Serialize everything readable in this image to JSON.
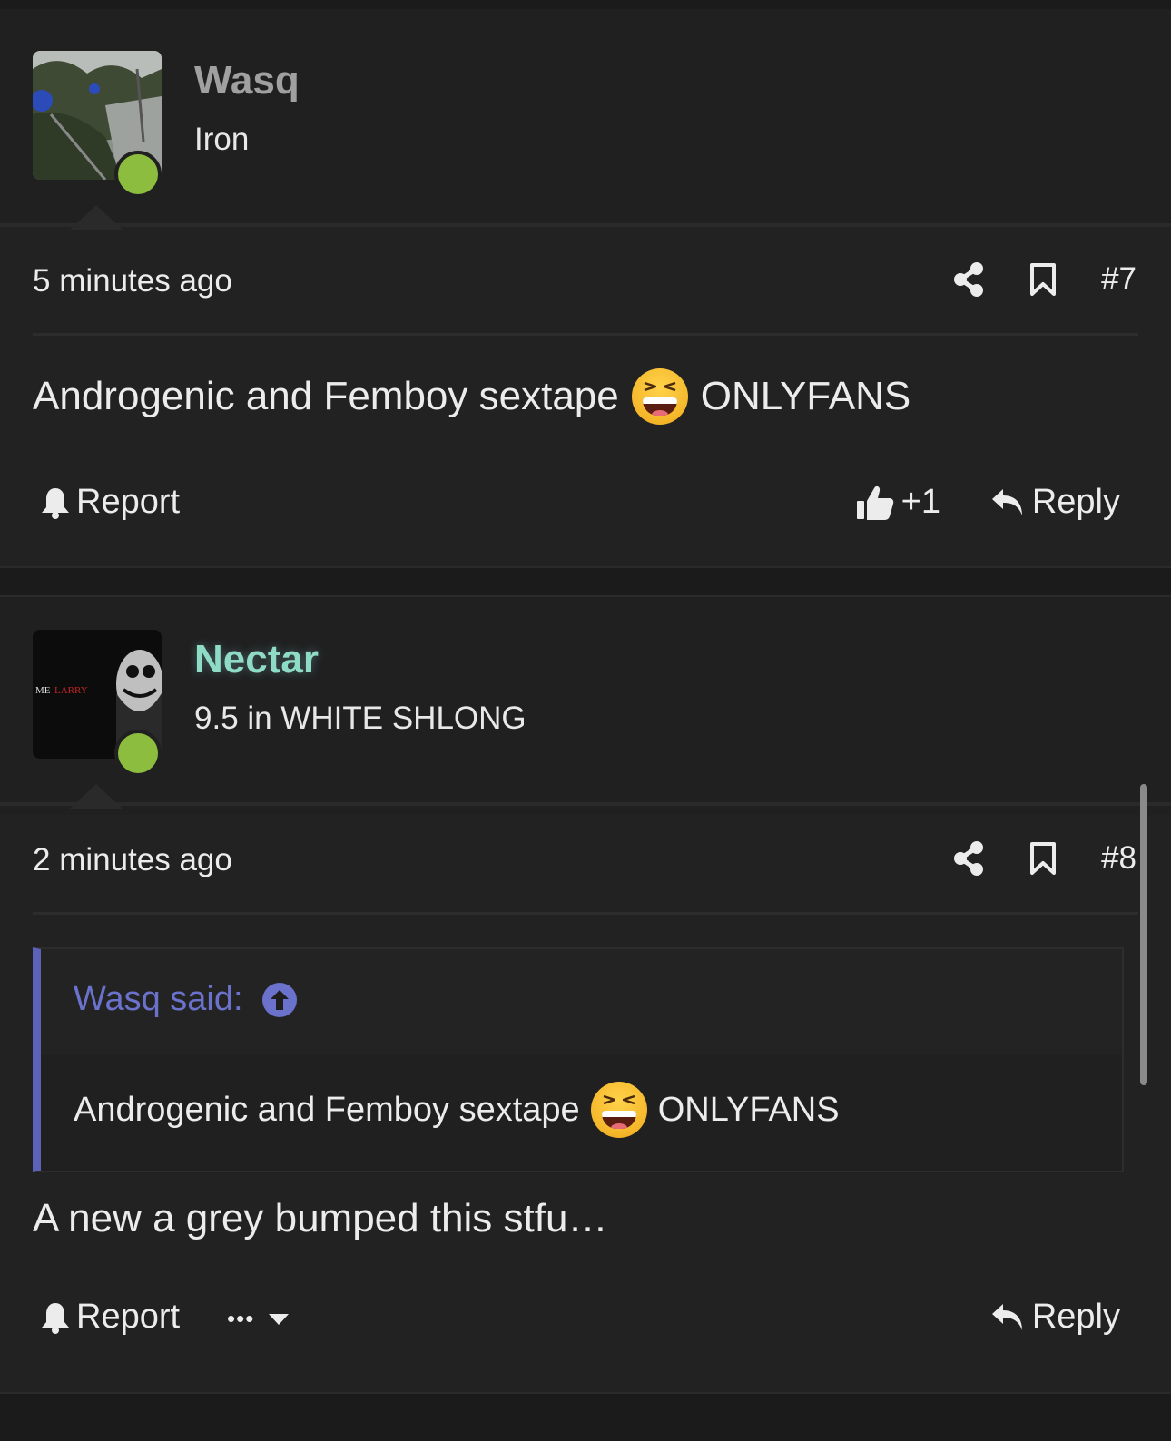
{
  "posts": [
    {
      "author": "Wasq",
      "author_color": "#a0a0a0",
      "user_title": "Iron",
      "timestamp": "5 minutes ago",
      "post_number": "#7",
      "content_before_emoji": "Androgenic and Femboy sextape",
      "emoji": "laughing-emoji",
      "content_after_emoji": "ONLYFANS",
      "report_label": "Report",
      "like_count": "+1",
      "reply_label": "Reply",
      "online": true
    },
    {
      "author": "Nectar",
      "author_color": "#8fdcc6",
      "user_title": "9.5 in WHITE SHLONG",
      "timestamp": "2 minutes ago",
      "post_number": "#8",
      "quote": {
        "author_label": "Wasq said:",
        "text_before_emoji": "Androgenic and Femboy sextape",
        "emoji": "laughing-emoji",
        "text_after_emoji": "ONLYFANS"
      },
      "content": "A new a grey bumped this stfu…",
      "report_label": "Report",
      "more_label": "•••",
      "reply_label": "Reply",
      "online": true,
      "avatar_text_white": "ME",
      "avatar_text_red": "LARRY"
    }
  ],
  "colors": {
    "background": "#1b1b1c",
    "post_bg": "#222223",
    "online": "#8cbd3f",
    "quote_accent": "#5b62b8",
    "quote_link": "#6a72cc"
  }
}
